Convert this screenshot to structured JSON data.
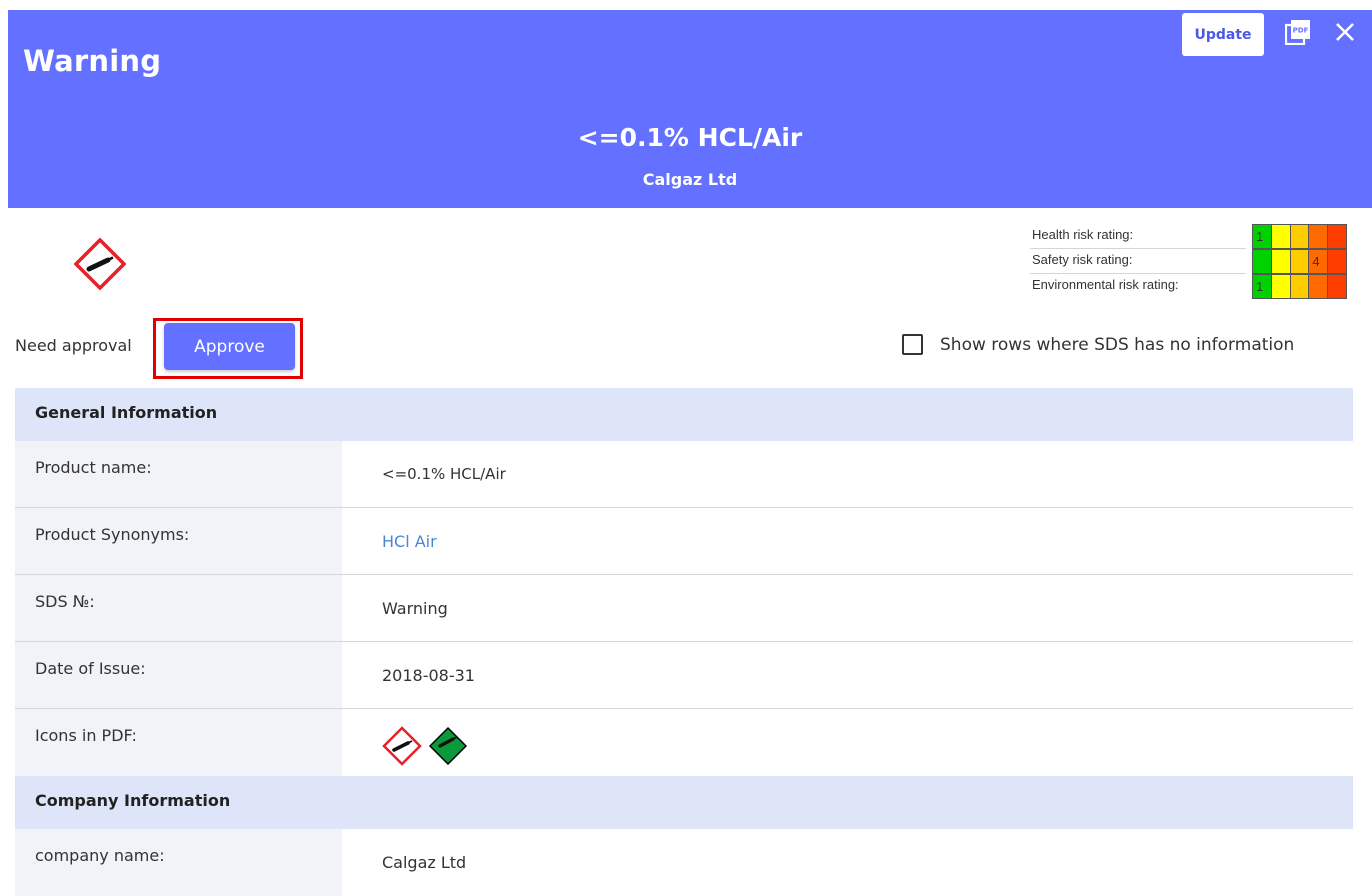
{
  "header": {
    "title": "Warning",
    "product_name": "<=0.1% HCL/Air",
    "company": "Calgaz Ltd",
    "update_label": "Update",
    "pdf_icon": "pdf-icon",
    "close_icon": "close-icon",
    "background_color": "#6470ff"
  },
  "hazard_pictograms": [
    "gas-cylinder-icon"
  ],
  "risk_ratings": {
    "health": {
      "label": "Health risk rating:",
      "value": "1"
    },
    "safety": {
      "label": "Safety risk rating:",
      "value": "4"
    },
    "environmental": {
      "label": "Environmental risk rating:",
      "value": "1"
    },
    "scale_colors": [
      "#00d100",
      "#ffff00",
      "#ffcc00",
      "#ff6a00",
      "#ff3d00"
    ]
  },
  "approval": {
    "status_text": "Need approval",
    "approve_label": "Approve"
  },
  "filter": {
    "show_empty_label": "Show rows where SDS has no information",
    "checked": false
  },
  "sections": {
    "general": {
      "title": "General Information",
      "rows": {
        "product_name": {
          "label": "Product name:",
          "value": "<=0.1% HCL/Air"
        },
        "synonyms": {
          "label": "Product Synonyms:",
          "value": "HCl Air"
        },
        "sds_no": {
          "label": "SDS №:",
          "value": "Warning"
        },
        "date_of_issue": {
          "label": "Date of Issue:",
          "value": "2018-08-31"
        },
        "icons_in_pdf": {
          "label": "Icons in PDF:",
          "icons": [
            "gas-cylinder-icon",
            "green-gas-cylinder-icon"
          ]
        }
      }
    },
    "company": {
      "title": "Company Information",
      "rows": {
        "company_name": {
          "label": "company name:",
          "value": "Calgaz Ltd"
        }
      }
    }
  }
}
